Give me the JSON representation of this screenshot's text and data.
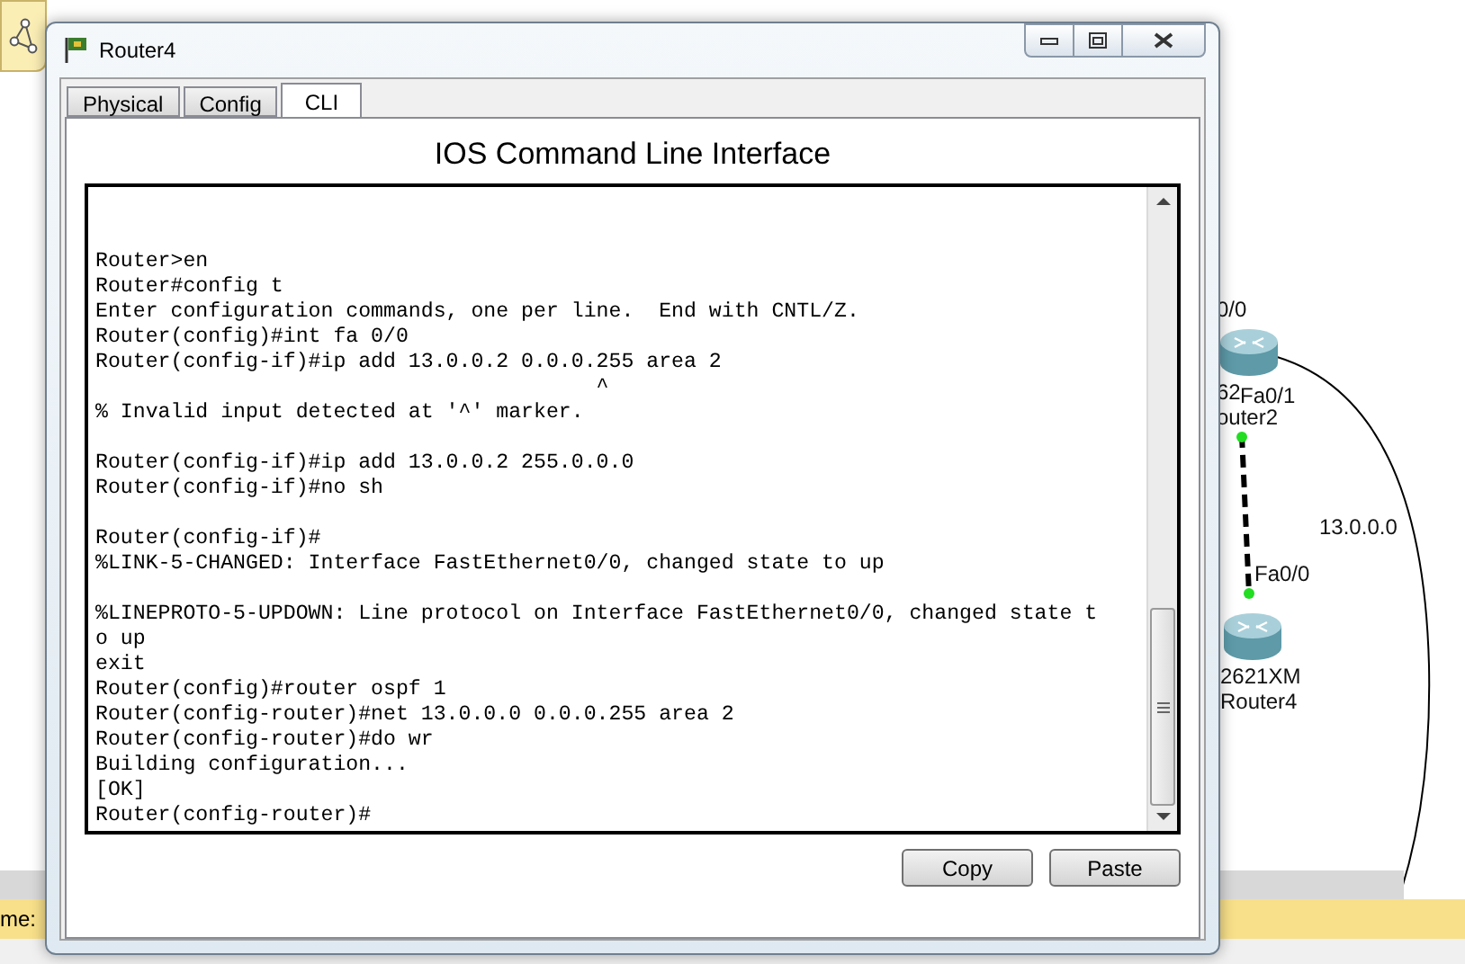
{
  "window": {
    "title": "Router4"
  },
  "tabs": [
    {
      "label": "Physical",
      "selected": false
    },
    {
      "label": "Config",
      "selected": false
    },
    {
      "label": "CLI",
      "selected": true
    }
  ],
  "cli": {
    "heading": "IOS Command Line Interface",
    "blocks": [
      [
        "Router>en",
        "Router#config t",
        "Enter configuration commands, one per line.  End with CNTL/Z.",
        "Router(config)#int fa 0/0",
        "Router(config-if)#ip add 13.0.0.2 0.0.0.255 area 2",
        "                                        ^",
        "% Invalid input detected at '^' marker."
      ],
      [
        "Router(config-if)#ip add 13.0.0.2 255.0.0.0",
        "Router(config-if)#no sh"
      ],
      [
        "Router(config-if)#",
        "%LINK-5-CHANGED: Interface FastEthernet0/0, changed state to up"
      ],
      [
        "%LINEPROTO-5-UPDOWN: Line protocol on Interface FastEthernet0/0, changed state t",
        "o up",
        "exit",
        "Router(config)#router ospf 1",
        "Router(config-router)#net 13.0.0.0 0.0.0.255 area 2",
        "Router(config-router)#do wr",
        "Building configuration...",
        "[OK]",
        "Router(config-router)#"
      ]
    ]
  },
  "buttons": [
    "Copy",
    "Paste"
  ],
  "canvas": {
    "labels": [
      {
        "text": "0/0"
      },
      {
        "text": "62"
      },
      {
        "text": "Fa0/1"
      },
      {
        "text": "outer2"
      },
      {
        "text": "13.0.0.0"
      },
      {
        "text": "Fa0/0"
      },
      {
        "text": "2621XM"
      },
      {
        "text": "Router4"
      }
    ]
  },
  "status_bar": {
    "label": "me:"
  }
}
